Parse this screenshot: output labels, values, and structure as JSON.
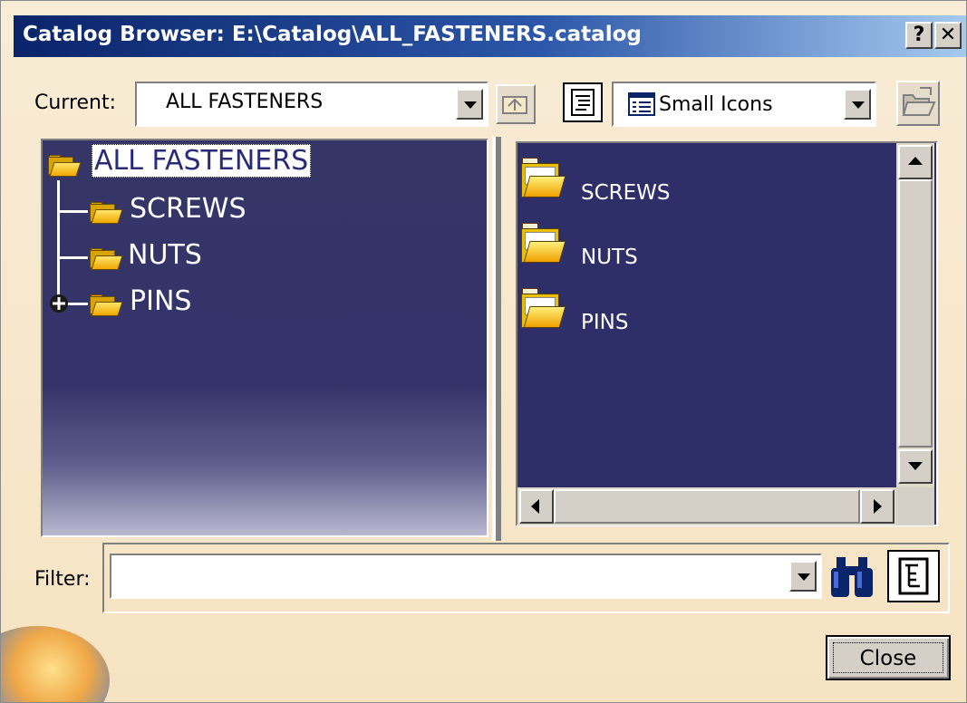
{
  "window": {
    "title": "Catalog Browser: E:\\Catalog\\ALL_FASTENERS.catalog",
    "help_label": "?",
    "close_label": "✕"
  },
  "current": {
    "label": "Current:",
    "value": "ALL FASTENERS"
  },
  "view": {
    "selected": "Small Icons"
  },
  "tree": {
    "root": "ALL FASTENERS",
    "children": [
      {
        "label": "SCREWS",
        "expandable": false
      },
      {
        "label": "NUTS",
        "expandable": false
      },
      {
        "label": "PINS",
        "expandable": true
      }
    ]
  },
  "list": {
    "items": [
      "SCREWS",
      "NUTS",
      "PINS"
    ]
  },
  "filter": {
    "label": "Filter:",
    "value": ""
  },
  "buttons": {
    "close": "Close"
  },
  "icons": {
    "up_level": "up-level-icon",
    "details_view": "details-view-icon",
    "view_mode": "small-icons-view-icon",
    "open": "open-folder-icon",
    "search": "binoculars-icon",
    "tree_filter": "tree-filter-icon"
  }
}
